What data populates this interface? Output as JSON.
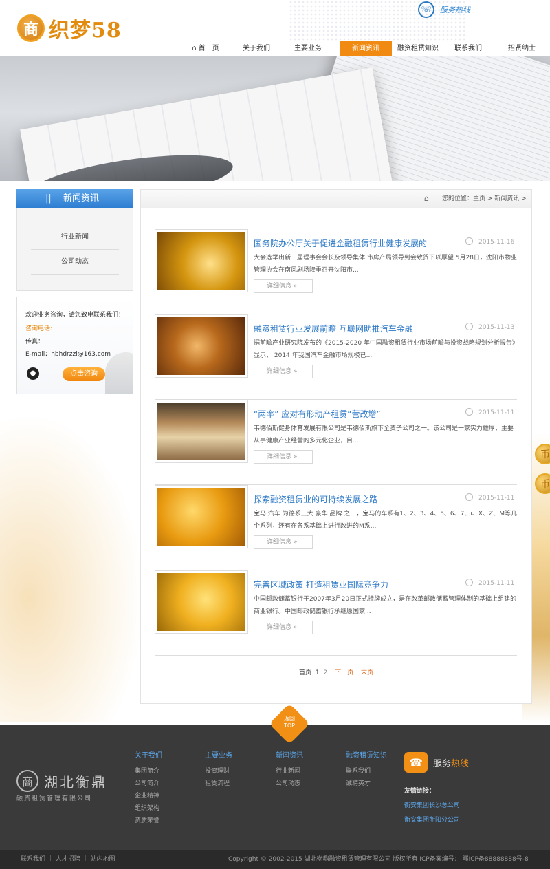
{
  "header": {
    "logo_text": "织梦58",
    "hotline_label": "服务热线",
    "nav": [
      {
        "label": "首　页",
        "active": false
      },
      {
        "label": "关于我们",
        "active": false
      },
      {
        "label": "主要业务",
        "active": false
      },
      {
        "label": "新闻资讯",
        "active": true
      },
      {
        "label": "融资租赁知识",
        "active": false
      },
      {
        "label": "联系我们",
        "active": false
      },
      {
        "label": "招贤纳士",
        "active": false
      }
    ]
  },
  "sidebar": {
    "title": "新闻资讯",
    "items": [
      "行业新闻",
      "公司动态"
    ],
    "contact": {
      "welcome": "欢迎业务咨询，请您致电联系我们！",
      "phone_label": "咨询电话:",
      "fax_label": "传真：",
      "email": "E-mail：hbhdrzzl@163.com",
      "consult_button": "点击咨询"
    }
  },
  "breadcrumb": "您的位置：主页 > 新闻资讯 >",
  "news": [
    {
      "title": "国务院办公厅关于促进金融租赁行业健康发展的",
      "date": "2015-11-16",
      "desc": "大会选举出新一届理事会会长及领导集体 市房产局领导到会致贺下以厚望 5月28日，沈阳市物业管理协会在南风剧场隆重召开沈阳市...",
      "more": "详细信息"
    },
    {
      "title": "融资租赁行业发展前瞻 互联网助推汽车金融",
      "date": "2015-11-13",
      "desc": "据前瞻产业研究院发布的《2015-2020 年中国融资租赁行业市场前瞻与投资战略规划分析报告》显示， 2014 年我国汽车金融市场规模已...",
      "more": "详细信息"
    },
    {
      "title": "“两率” 应对有形动产租赁“营改增”",
      "date": "2015-11-11",
      "desc": "韦德佰斯健身体育发展有限公司是韦德佰斯旗下全资子公司之一。该公司是一家实力雄厚，主要从事健康产业经营的多元化企业，目...",
      "more": "详细信息"
    },
    {
      "title": "探索融资租赁业的可持续发展之路",
      "date": "2015-11-11",
      "desc": "宝马 汽车 为德系三大 豪华 品牌 之一，宝马的车系有1、2、3、4、5、6、7、i、X、Z、M等几个系列，还有在各系基础上进行改进的M系...",
      "more": "详细信息"
    },
    {
      "title": "完善区域政策 打造租赁业国际竞争力",
      "date": "2015-11-11",
      "desc": "中国邮政储蓄银行于2007年3月20日正式挂牌成立，是在改革邮政储蓄管理体制的基础上组建的商业银行。中国邮政储蓄银行承继原国家...",
      "more": "详细信息"
    }
  ],
  "pager": {
    "first": "首页",
    "current": "1",
    "page2": "2",
    "next": "下一页",
    "last": "末页"
  },
  "top_button": {
    "line1": "返回",
    "line2": "TOP"
  },
  "footer": {
    "logo_name": "湖北衡鼎",
    "logo_sub": "融资租赁管理有限公司",
    "columns": [
      {
        "heading": "关于我们",
        "links": [
          "集团简介",
          "公司简介",
          "企业精神",
          "组织架构",
          "资质荣誉"
        ]
      },
      {
        "heading": "主要业务",
        "links": [
          "投资理财",
          "租赁流程"
        ]
      },
      {
        "heading": "新闻资讯",
        "links": [
          "行业新闻",
          "公司动态"
        ]
      },
      {
        "heading": "融资租赁知识",
        "links": [
          "联系我们",
          "诚聘英才"
        ]
      }
    ],
    "service_a": "服务",
    "service_b": "热线",
    "friend_label": "友情链接：",
    "friends": [
      "衡安集团长沙总公司",
      "衡安集团衡阳分公司"
    ]
  },
  "bottom": {
    "links": "联系我们 ｜ 人才招聘 ｜ 站内地图",
    "copyright": "Copyright © 2002-2015 湖北衡鼎融资租赁管理有限公司 版权所有  ICP备案编号： 鄂ICP备88888888号-8"
  },
  "colors": {
    "accent": "#f08a12",
    "link": "#2f7ac7",
    "footer_bg": "#3a3a3a"
  }
}
